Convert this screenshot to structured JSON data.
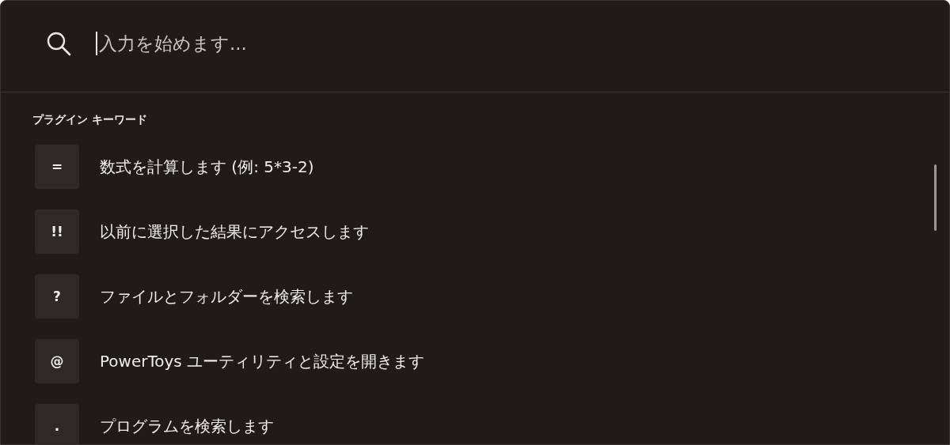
{
  "search": {
    "placeholder": "入力を始めます..."
  },
  "section_title": "プラグイン キーワード",
  "items": [
    {
      "key": "=",
      "description": "数式を計算します (例: 5*3-2)"
    },
    {
      "key": "!!",
      "description": "以前に選択した結果にアクセスします"
    },
    {
      "key": "?",
      "description": "ファイルとフォルダーを検索します"
    },
    {
      "key": "@",
      "description": "PowerToys ユーティリティと設定を開きます"
    },
    {
      "key": ".",
      "description": "プログラムを検索します"
    }
  ]
}
